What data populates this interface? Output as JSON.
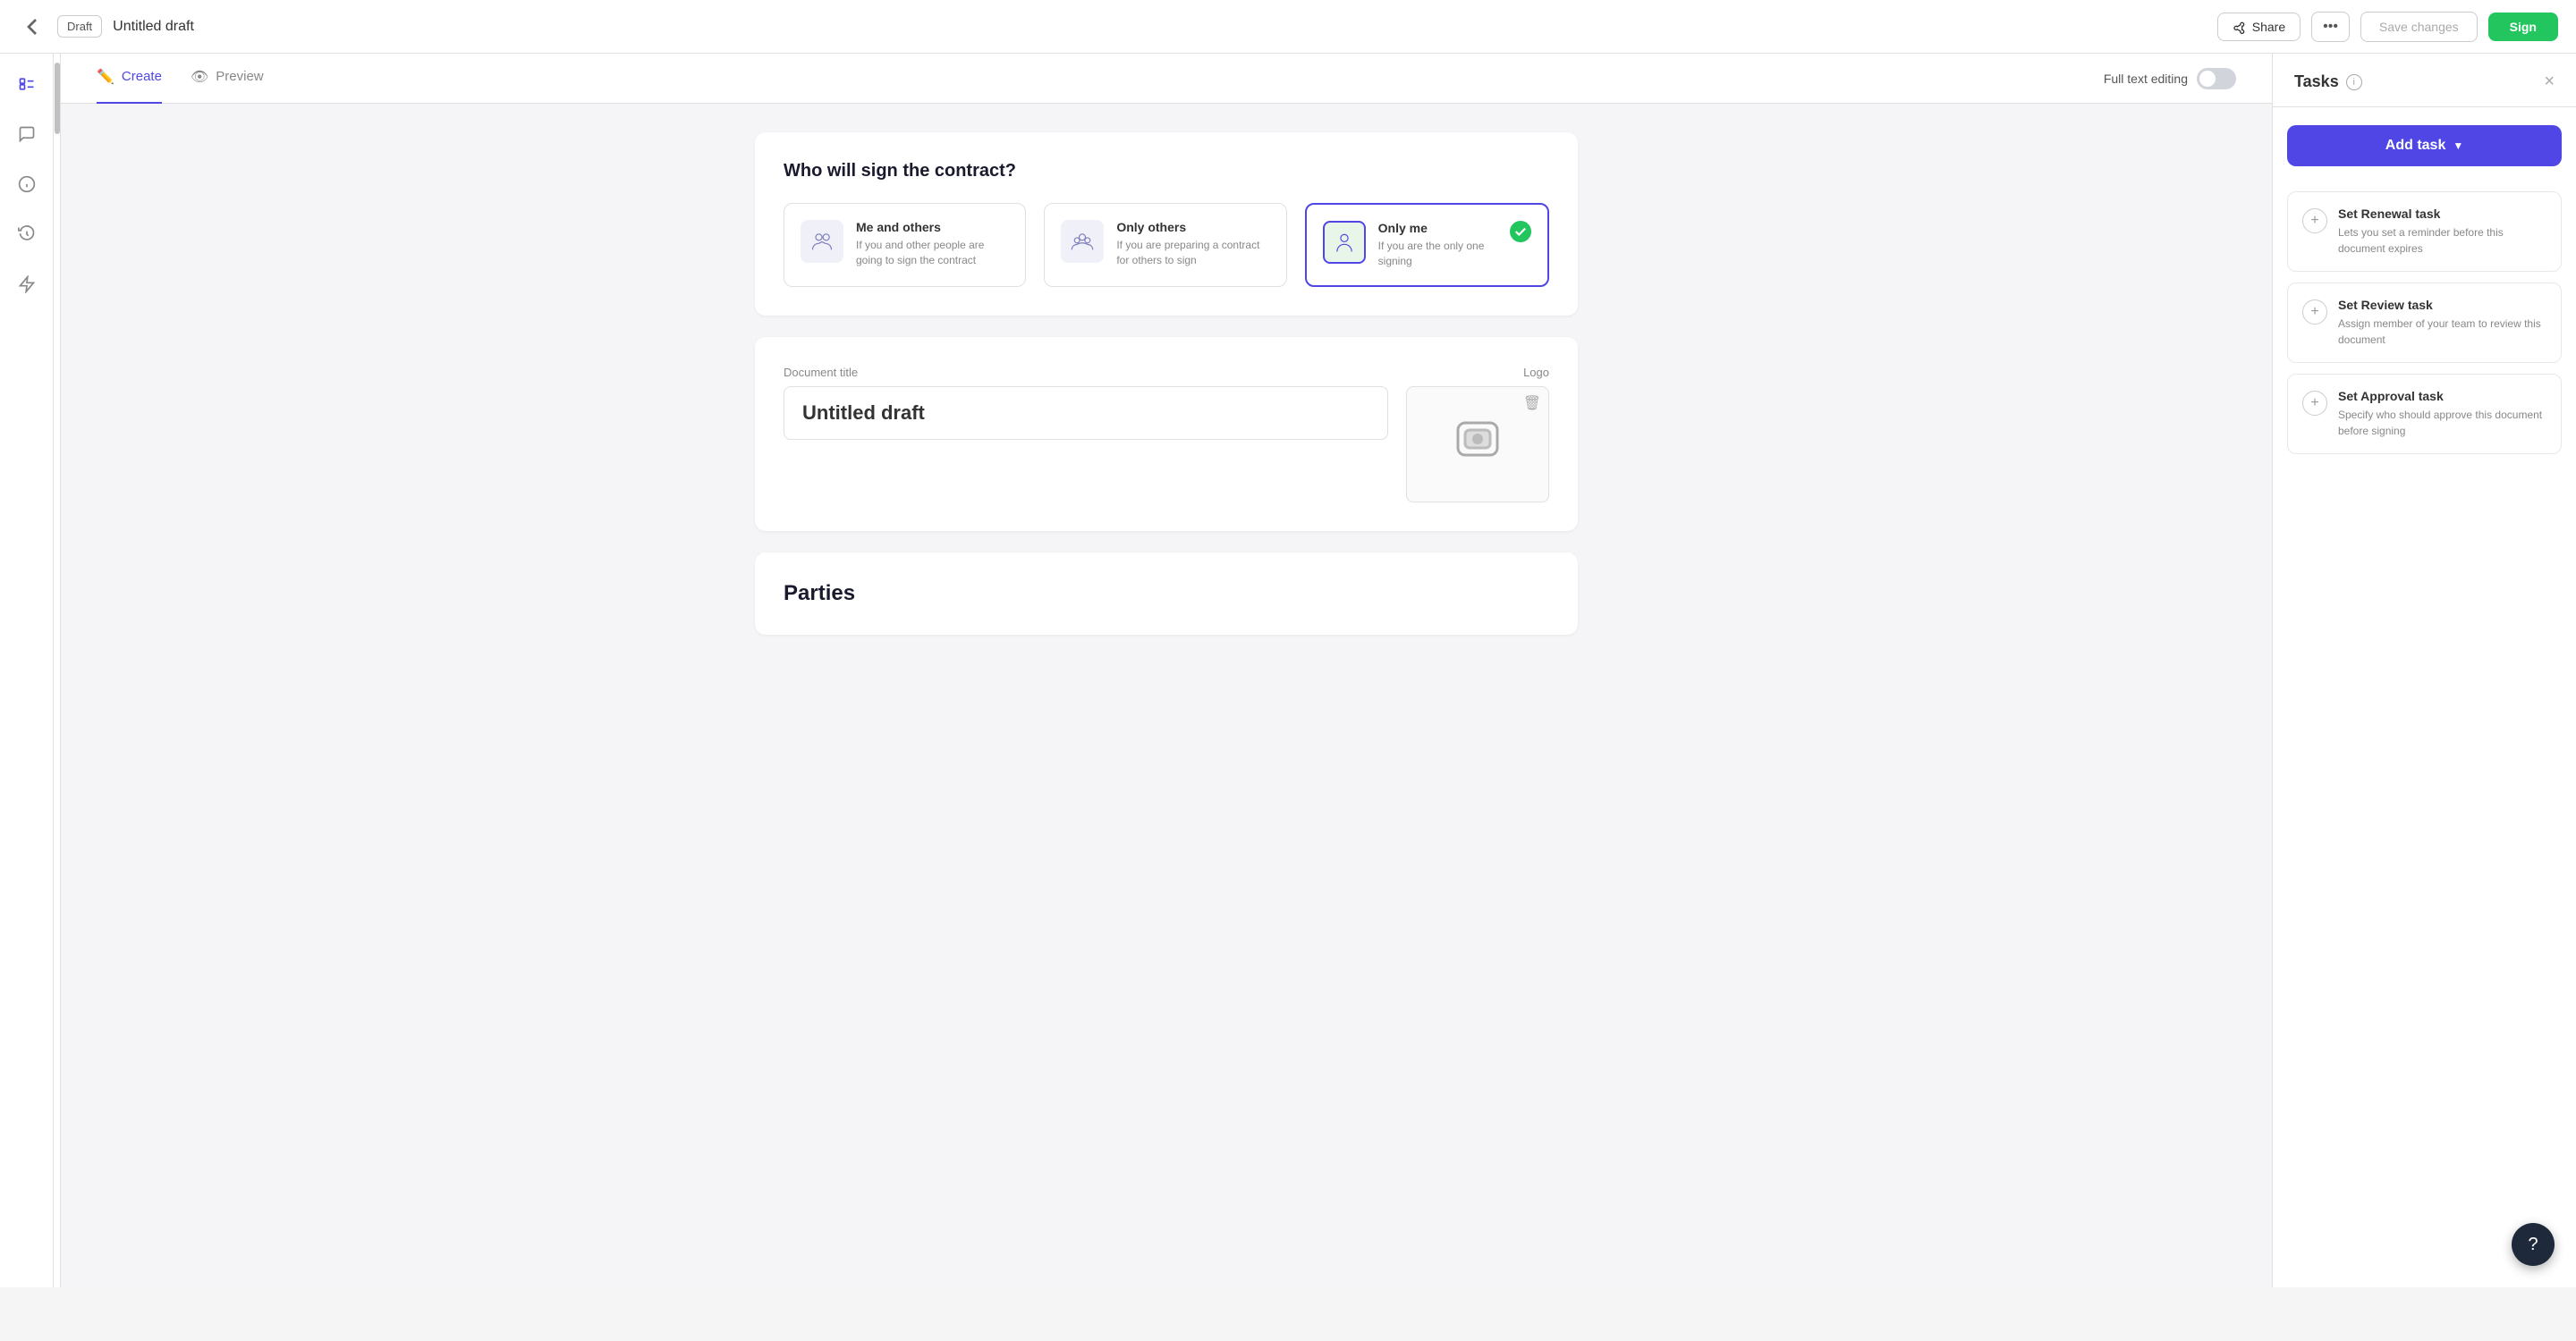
{
  "header": {
    "back_icon": "←",
    "draft_label": "Draft",
    "doc_title": "Untitled draft",
    "share_label": "Share",
    "more_icon": "•••",
    "save_label": "Save changes",
    "sign_label": "Sign"
  },
  "tabs": {
    "create_label": "Create",
    "preview_label": "Preview",
    "full_text_label": "Full text editing"
  },
  "signing": {
    "question": "Who will sign the contract?",
    "options": [
      {
        "title": "Me and others",
        "desc": "If you and other people are going to sign the contract",
        "selected": false
      },
      {
        "title": "Only others",
        "desc": "If you are preparing a contract for others to sign",
        "selected": false
      },
      {
        "title": "Only me",
        "desc": "If you are the only one signing",
        "selected": true
      }
    ]
  },
  "document": {
    "title_label": "Document title",
    "title_value": "Untitled draft",
    "logo_label": "Logo"
  },
  "parties": {
    "title": "Parties"
  },
  "tasks_panel": {
    "title": "Tasks",
    "close_icon": "×",
    "add_task_label": "Add task",
    "items": [
      {
        "title": "Set Renewal task",
        "desc": "Lets you set a reminder before this document expires"
      },
      {
        "title": "Set Review task",
        "desc": "Assign member of your team to review this document"
      },
      {
        "title": "Set Approval task",
        "desc": "Specify who should approve this document before signing"
      }
    ]
  },
  "help": {
    "icon": "?"
  }
}
